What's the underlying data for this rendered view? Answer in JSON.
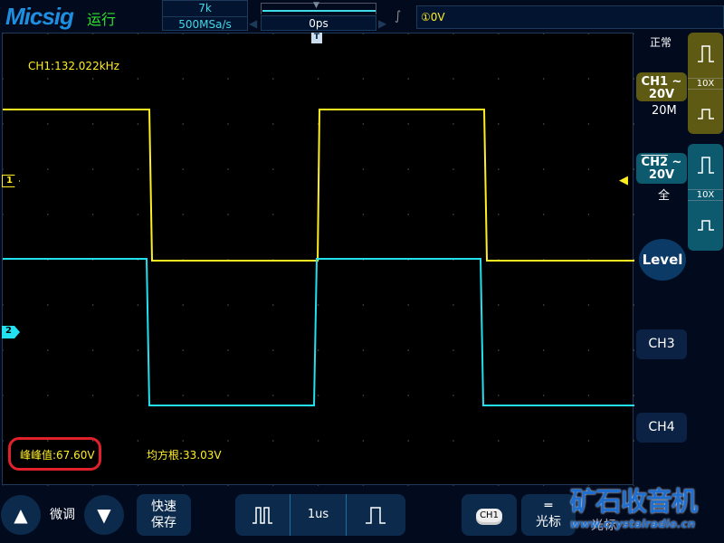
{
  "header": {
    "logo": "Micsig",
    "run_state": "运行",
    "memory_depth": "7k",
    "sample_rate": "500MSa/s",
    "horizontal_delay": "0ps",
    "trigger_level": "①0V"
  },
  "screen": {
    "frequency": "CH1:132.022kHz",
    "measurements": [
      {
        "label": "峰峰值:67.60V"
      },
      {
        "label": "均方根:33.03V"
      }
    ],
    "markers": {
      "ch1": "1",
      "ch2": "2",
      "trigger": "T"
    }
  },
  "side": {
    "acq_mode": "正常",
    "ch1": {
      "name": "CH1",
      "coupling": "~",
      "scale": "20V",
      "bandwidth": "20M",
      "probe": "10X",
      "color": "#ffee22",
      "panel_color": "#5e5a14"
    },
    "ch2": {
      "name": "CH2",
      "coupling": "~",
      "scale": "20V",
      "bandwidth": "全",
      "probe": "10X",
      "color": "#22e0f0",
      "panel_color": "#0d5a6e"
    },
    "level": "Level",
    "ch3": "CH3",
    "ch4": "CH4"
  },
  "bottom": {
    "fine_adjust": "微调",
    "quick_save_1": "快速",
    "quick_save_2": "保存",
    "timebase": "1us",
    "cursor_ch": "CH1",
    "cursor": "光标",
    "cursor2": "光标"
  },
  "watermark": {
    "title": "矿石收音机",
    "url": "www.crystalradio.cn"
  }
}
